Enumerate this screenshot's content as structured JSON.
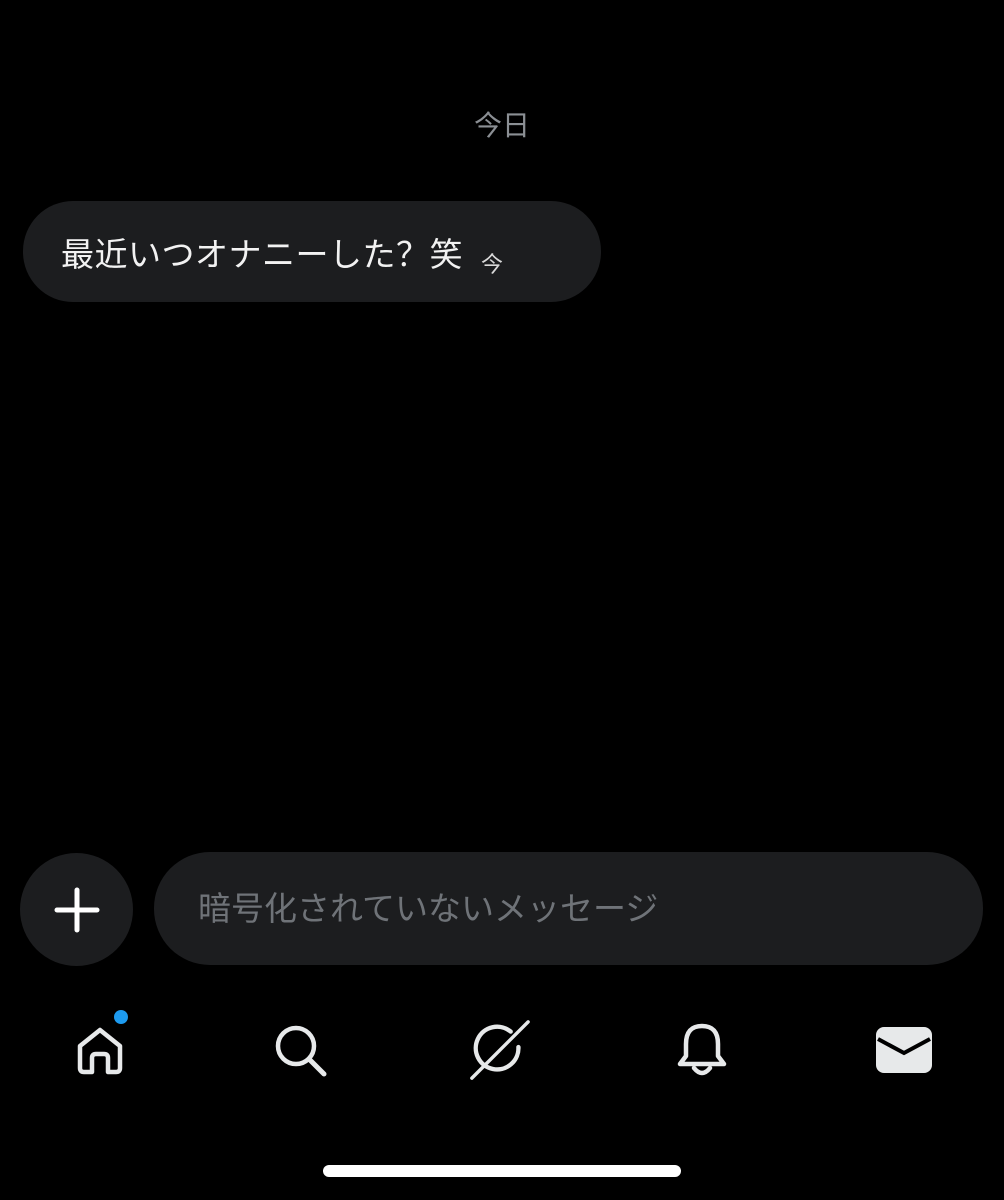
{
  "conversation": {
    "date_divider": "今日",
    "messages": [
      {
        "text": "最近いつオナニーした？笑",
        "time": "今"
      }
    ]
  },
  "composer": {
    "placeholder": "暗号化されていないメッセージ",
    "add_icon": "plus-icon"
  },
  "tab_bar": {
    "items": [
      {
        "icon": "home-icon",
        "has_notification_dot": true
      },
      {
        "icon": "search-icon",
        "has_notification_dot": false
      },
      {
        "icon": "grok-icon",
        "has_notification_dot": false
      },
      {
        "icon": "bell-icon",
        "has_notification_dot": false
      },
      {
        "icon": "envelope-icon",
        "has_notification_dot": false,
        "active": true
      }
    ]
  },
  "colors": {
    "background": "#000000",
    "bubble": "#1c1d1f",
    "notification_dot": "#1d9bf0",
    "placeholder": "#6f7378"
  }
}
